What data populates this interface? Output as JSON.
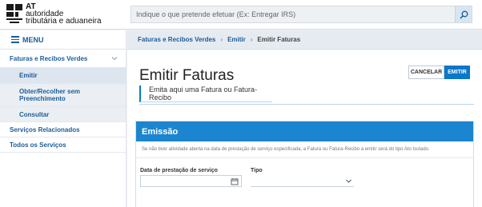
{
  "header": {
    "logo": {
      "line1": "AT",
      "line2": "autoridade",
      "line3": "tributária e aduaneira"
    },
    "search": {
      "placeholder": "Indique o que pretende efetuar (Ex: Entregar IRS)",
      "value": ""
    }
  },
  "sidebar": {
    "menu_label": "MENU",
    "items": [
      {
        "label": "Faturas e Recibos Verdes",
        "level": "top"
      },
      {
        "label": "Emitir",
        "level": "sub"
      },
      {
        "label": "Obter/Recolher sem Preenchimento",
        "level": "sub"
      },
      {
        "label": "Consultar",
        "level": "sub"
      },
      {
        "label": "Serviços Relacionados",
        "level": "top"
      },
      {
        "label": "Todos os Serviços",
        "level": "top"
      }
    ]
  },
  "breadcrumb": {
    "items": [
      "Faturas e Recibos Verdes",
      "Emitir",
      "Emitir Faturas"
    ]
  },
  "main": {
    "title": "Emitir Faturas",
    "subtitle": "Emita aqui uma Fatura ou Fatura-Recibo",
    "cancel_label": "CANCELAR",
    "emit_label": "EMITIR",
    "panel": {
      "heading": "Emissão",
      "note": "Se não tiver atividade aberta na data de prestação de serviço especificada, a Fatura ou Fatura-Recibo a emitir será do tipo Ato Isolado.",
      "date_label": "Data de prestação de serviço",
      "date_value": "",
      "tipo_label": "Tipo",
      "tipo_value": ""
    }
  },
  "colors": {
    "primary": "#0b77c7",
    "panel_header": "#1c85d0",
    "link": "#1b5c97"
  }
}
